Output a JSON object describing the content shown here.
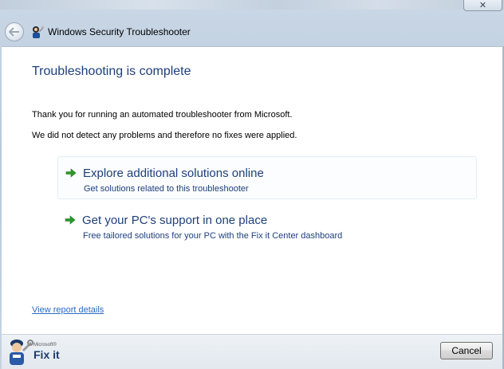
{
  "window": {
    "title": "Windows Security Troubleshooter",
    "close_glyph": "✕"
  },
  "content": {
    "heading": "Troubleshooting is complete",
    "paragraph1": "Thank you for running an automated troubleshooter from Microsoft.",
    "paragraph2": "We did not detect any problems and therefore no fixes were applied.",
    "options": [
      {
        "title": "Explore additional solutions online",
        "description": "Get solutions related to this troubleshooter",
        "icon": "green-arrow-icon"
      },
      {
        "title": "Get your PC's support in one place",
        "description": "Free tailored solutions for your PC with the Fix it Center dashboard",
        "icon": "green-arrow-icon"
      }
    ],
    "report_link": "View report details"
  },
  "footer": {
    "brand_small": "Microsoft®",
    "brand_big": "Fix it",
    "cancel_label": "Cancel"
  },
  "colors": {
    "heading": "#1e3f7a",
    "link": "#2b6ac2",
    "arrow": "#2a9a2a"
  }
}
